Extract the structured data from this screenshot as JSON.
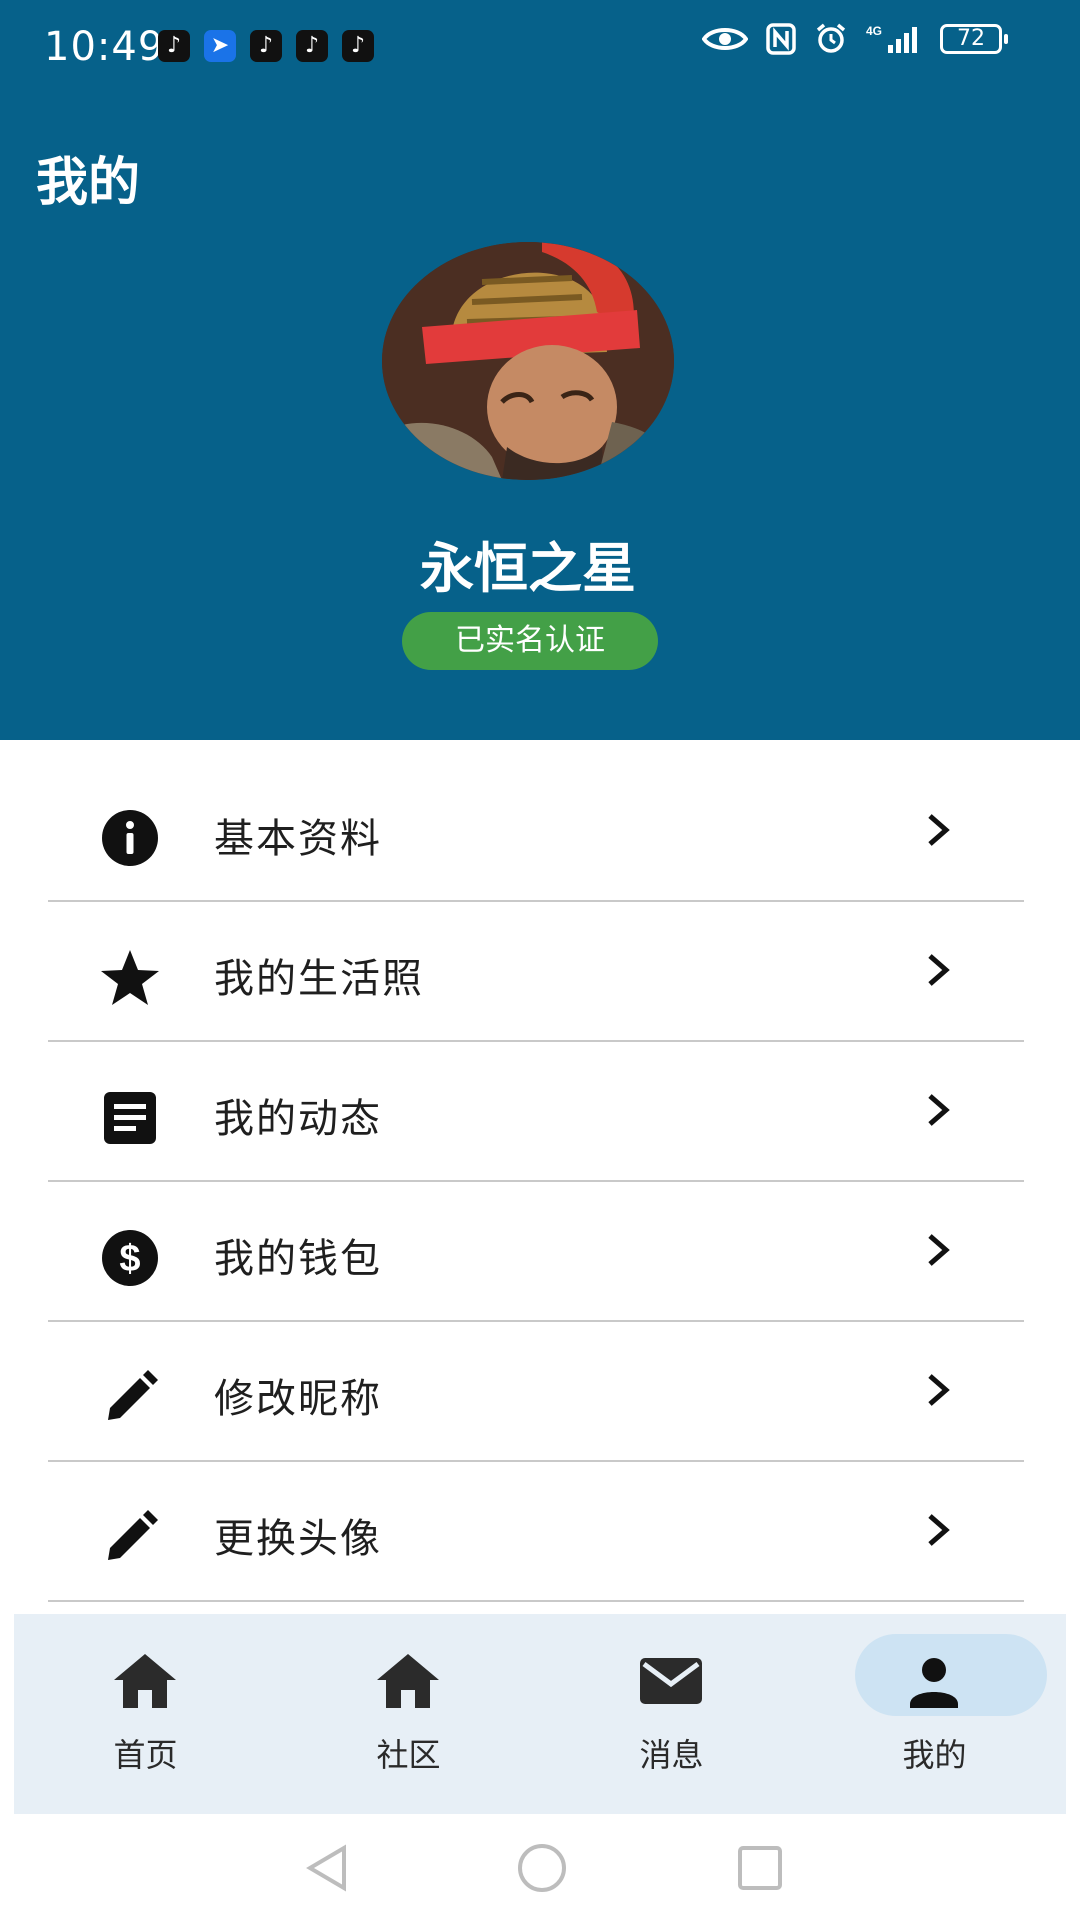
{
  "status_bar": {
    "time": "10:49",
    "network": "4G",
    "battery": "72",
    "app_icons": [
      "tiktok-icon",
      "feishu-icon",
      "tiktok-icon",
      "tiktok-icon",
      "tiktok-icon"
    ]
  },
  "header": {
    "title": "我的",
    "background_color": "#06618a"
  },
  "profile": {
    "username": "永恒之星",
    "verified_label": "已实名认证",
    "verified_color": "#43a047"
  },
  "menu": {
    "items": [
      {
        "label": "基本资料",
        "icon": "info-icon"
      },
      {
        "label": "我的生活照",
        "icon": "star-icon"
      },
      {
        "label": "我的动态",
        "icon": "article-icon"
      },
      {
        "label": "我的钱包",
        "icon": "dollar-icon"
      },
      {
        "label": "修改昵称",
        "icon": "pencil-icon"
      },
      {
        "label": "更换头像",
        "icon": "pencil-icon"
      }
    ]
  },
  "bottom_nav": {
    "items": [
      {
        "label": "首页",
        "icon": "home-icon"
      },
      {
        "label": "社区",
        "icon": "home-icon"
      },
      {
        "label": "消息",
        "icon": "mail-icon"
      },
      {
        "label": "我的",
        "icon": "person-icon"
      }
    ],
    "active_index": 3
  }
}
